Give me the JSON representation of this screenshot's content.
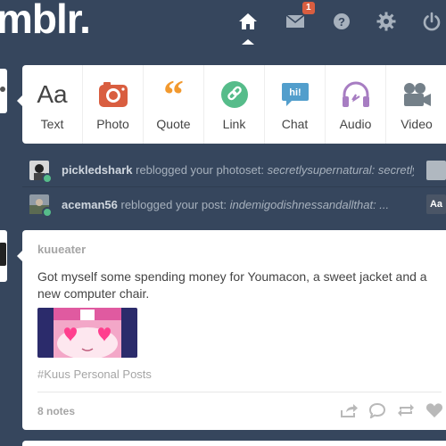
{
  "header": {
    "logo": "mblr.",
    "mail_count": "1",
    "nav": [
      "home-icon",
      "mail-icon",
      "help-icon",
      "gear-icon",
      "power-icon"
    ]
  },
  "composer": {
    "types": [
      {
        "label": "Text",
        "glyph": "Aa",
        "color": "#444444"
      },
      {
        "label": "Photo",
        "color": "#d95e40"
      },
      {
        "label": "Quote",
        "glyph": "66",
        "color": "#f2992e"
      },
      {
        "label": "Link",
        "color": "#56bc8a"
      },
      {
        "label": "Chat",
        "glyph": "hi!",
        "color": "#529ecc"
      },
      {
        "label": "Audio",
        "color": "#a77dc2"
      },
      {
        "label": "Video",
        "color": "#748089"
      }
    ]
  },
  "activity": [
    {
      "user": "pickledshark",
      "action": " reblogged your photoset: ",
      "snippet": "secretlysupernatural: secretlysu..."
    },
    {
      "user": "aceman56",
      "action": " reblogged your post: ",
      "snippet": "indemigodishnessandallthat: ...",
      "thumb_text": "Aa"
    }
  ],
  "post": {
    "author": "kuueater",
    "body": "Got myself some spending money for Youmacon, a sweet jacket and a new computer chair.",
    "tags": "#Kuus Personal Posts",
    "notes": "8 notes"
  },
  "colors": {
    "background": "#36465d",
    "accent_badge": "#d95e40"
  }
}
